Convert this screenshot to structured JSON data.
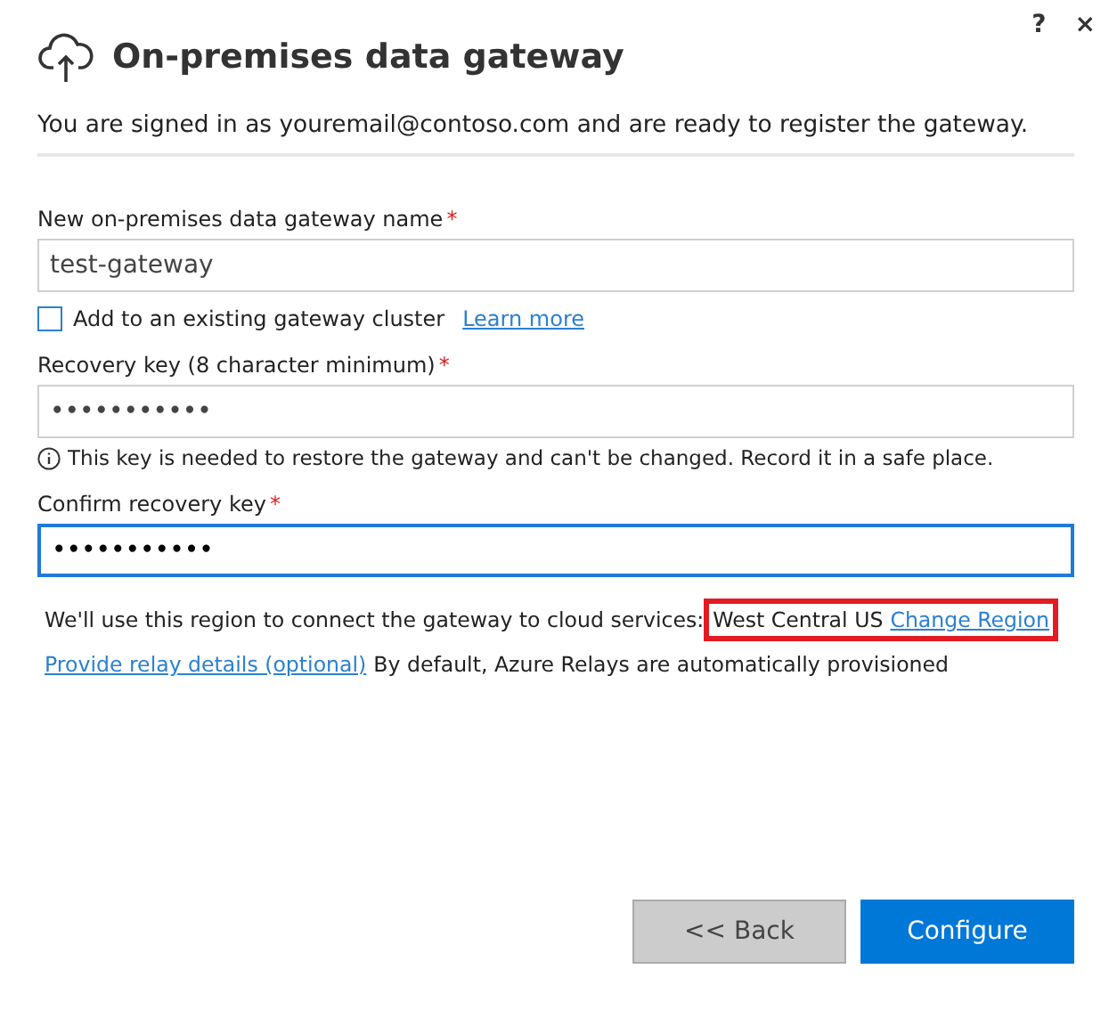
{
  "window": {
    "title": "On-premises data gateway",
    "help": "?",
    "close": "×"
  },
  "subtitle": "You are signed in as youremail@contoso.com and are ready to register the gateway.",
  "name_field": {
    "label": "New on-premises data gateway name",
    "required_mark": "*",
    "value": "test-gateway",
    "focused": false
  },
  "cluster": {
    "label": "Add to an existing gateway cluster",
    "checked": false,
    "link": "Learn more"
  },
  "recovery_field": {
    "label": "Recovery key (8 character minimum)",
    "required_mark": "*",
    "value": "•••••••••••",
    "focused": false
  },
  "recovery_note": "This key is needed to restore the gateway and can't be changed. Record it in a safe place.",
  "confirm_field": {
    "label": "Confirm recovery key",
    "required_mark": "*",
    "value": "•••••••••••",
    "focused": true
  },
  "region": {
    "text": "We'll use this region to connect the gateway to cloud services:",
    "value": "West Central US",
    "link": "Change Region",
    "highlighted": true
  },
  "relay": {
    "link": "Provide relay details (optional)",
    "text": "By default, Azure Relays are automatically provisioned"
  },
  "buttons": [
    {
      "label": "<< Back",
      "kind": "secondary"
    },
    {
      "label": "Configure",
      "kind": "primary"
    }
  ]
}
